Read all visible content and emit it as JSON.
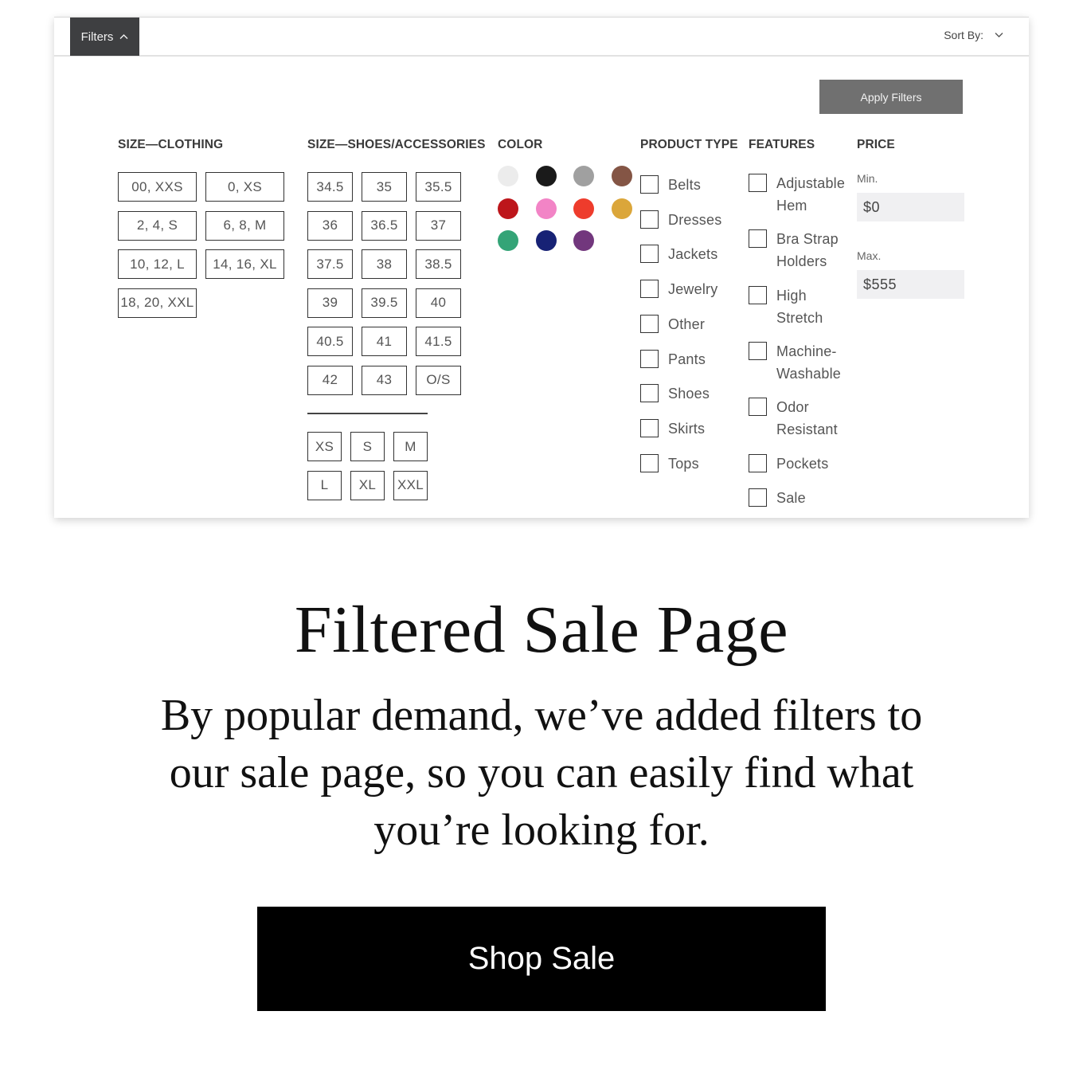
{
  "toolbar": {
    "filters_label": "Filters",
    "filters_icon": "chevron-up-icon",
    "sort_label": "Sort By:",
    "sort_icon": "chevron-down-icon"
  },
  "apply_label": "Apply Filters",
  "size_clothing": {
    "heading": "SIZE—CLOTHING",
    "options": [
      "00, XXS",
      "0, XS",
      "2, 4, S",
      "6, 8, M",
      "10, 12, L",
      "14, 16, XL",
      "18, 20, XXL"
    ]
  },
  "size_shoes": {
    "heading": "SIZE—SHOES/ACCESSORIES",
    "options": [
      "34.5",
      "35",
      "35.5",
      "36",
      "36.5",
      "37",
      "37.5",
      "38",
      "38.5",
      "39",
      "39.5",
      "40",
      "40.5",
      "41",
      "41.5",
      "42",
      "43",
      "O/S"
    ],
    "apparel_options": [
      "XS",
      "S",
      "M",
      "L",
      "XL",
      "XXL"
    ]
  },
  "color": {
    "heading": "COLOR",
    "swatches": [
      {
        "name": "white",
        "hex": "#ececec"
      },
      {
        "name": "black",
        "hex": "#1a1a1a"
      },
      {
        "name": "gray",
        "hex": "#a0a0a0"
      },
      {
        "name": "brown",
        "hex": "#845545"
      },
      {
        "name": "red",
        "hex": "#bd161b"
      },
      {
        "name": "pink",
        "hex": "#f284c6"
      },
      {
        "name": "orange-red",
        "hex": "#ee3c2c"
      },
      {
        "name": "gold",
        "hex": "#dba63a"
      },
      {
        "name": "green",
        "hex": "#34a477"
      },
      {
        "name": "navy",
        "hex": "#172275"
      },
      {
        "name": "purple",
        "hex": "#72377d"
      }
    ]
  },
  "product_type": {
    "heading": "PRODUCT TYPE",
    "items": [
      "Belts",
      "Dresses",
      "Jackets",
      "Jewelry",
      "Other",
      "Pants",
      "Shoes",
      "Skirts",
      "Tops"
    ]
  },
  "features": {
    "heading": "FEATURES",
    "items": [
      "Adjustable Hem",
      "Bra Strap Holders",
      "High Stretch",
      "Machine-Washable",
      "Odor Resistant",
      "Pockets",
      "Sale"
    ]
  },
  "price": {
    "heading": "PRICE",
    "min_label": "Min.",
    "min_value": "$0",
    "max_label": "Max.",
    "max_value": "$555"
  },
  "promo": {
    "headline": "Filtered Sale Page",
    "body": "By popular demand, we’ve added filters to our sale page, so you can easily find what you’re looking for.",
    "cta": "Shop Sale"
  }
}
